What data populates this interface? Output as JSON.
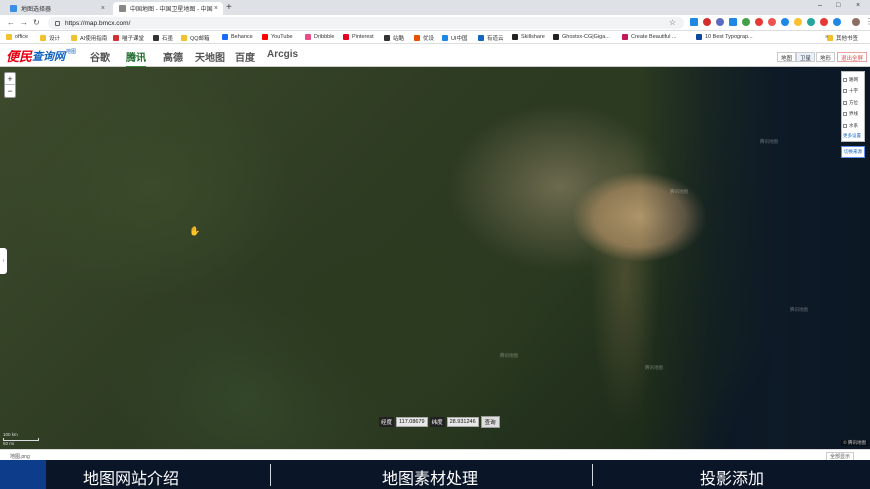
{
  "browser": {
    "tabs": [
      {
        "label": "地图选择器",
        "close": "×"
      },
      {
        "label": "中国地图 - 中国卫星地图 - 中国",
        "close": "×"
      }
    ],
    "new_tab": "+",
    "window_controls": [
      "–",
      "□",
      "×"
    ],
    "url": "https://map.bmcx.com/",
    "bookmarks": [
      {
        "label": "office",
        "color": "#f2c12e"
      },
      {
        "label": "设计",
        "color": "#f2c12e"
      },
      {
        "label": "AI使用指南",
        "color": "#f2c12e"
      },
      {
        "label": "喵子课堂",
        "color": "#d32f2f"
      },
      {
        "label": "石墨",
        "color": "#333333"
      },
      {
        "label": "QQ邮箱",
        "color": "#f2c12e"
      },
      {
        "label": "Behance",
        "color": "#1769ff"
      },
      {
        "label": "YouTube",
        "color": "#ff0000"
      },
      {
        "label": "Dribbble",
        "color": "#ea4c89"
      },
      {
        "label": "Pinterest",
        "color": "#e60023"
      },
      {
        "label": "站酷",
        "color": "#333333"
      },
      {
        "label": "优设",
        "color": "#e65100"
      },
      {
        "label": "UI中国",
        "color": "#1e88e5"
      },
      {
        "label": "有道云",
        "color": "#1565c0"
      },
      {
        "label": "Skillshare",
        "color": "#222222"
      },
      {
        "label": "Ghostxx-CG|Giga...",
        "color": "#222222"
      },
      {
        "label": "Create Beautiful ...",
        "color": "#c2185b"
      },
      {
        "label": "10 Best Typograp...",
        "color": "#0d47a1"
      }
    ],
    "bookmarks_more": "»",
    "bookmarks_other": "其他书签"
  },
  "site": {
    "logo_main": "便民",
    "logo_second": "查询网",
    "logo_sub": "地图",
    "nav_tabs": [
      "谷歌",
      "腾讯",
      "高德",
      "天地图",
      "百度",
      "Arcgis"
    ],
    "active_tab": "腾讯",
    "map_types": [
      "地图",
      "卫星",
      "地形",
      "退出全屏"
    ]
  },
  "map": {
    "zoom_in": "+",
    "zoom_out": "−",
    "layers": [
      "路网",
      "十字",
      "方位",
      "界线",
      "水系"
    ],
    "more_settings": "更多设置",
    "map_source": "切换来源",
    "side_handle": "‹",
    "coord_lon_label": "经度",
    "coord_lon_value": "117.08679",
    "coord_lat_label": "纬度",
    "coord_lat_value": "28.931246",
    "query_button": "查询",
    "scale_top": "100 km",
    "scale_bottom": "50 mi",
    "attribution": "© 腾讯地图",
    "watermark": "腾讯地图"
  },
  "download_bar": {
    "item": "地图.png",
    "show_all": "全部显示"
  },
  "caption": {
    "items": [
      "地图网站介绍",
      "地图素材处理",
      "投影添加"
    ]
  }
}
